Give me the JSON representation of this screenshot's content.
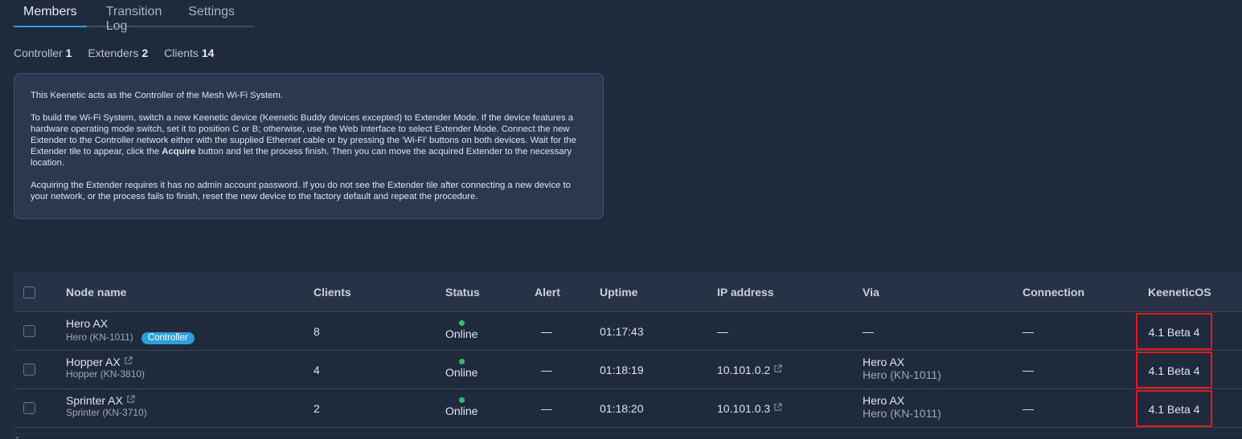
{
  "tabs": [
    "Members",
    "Transition Log",
    "Settings"
  ],
  "counts": [
    {
      "label": "Controller",
      "value": "1"
    },
    {
      "label": "Extenders",
      "value": "2"
    },
    {
      "label": "Clients",
      "value": "14"
    }
  ],
  "info": {
    "p1": "This Keenetic acts as the Controller of the Mesh Wi-Fi System.",
    "p2_a": "To build the Wi-Fi System, switch a new Keenetic device (Keenetic Buddy devices excepted) to Extender Mode. If the device features a hardware operating mode switch, set it to position C or B; otherwise, use the Web Interface to select Extender Mode. Connect the new Extender to the Controller network either with the supplied Ethernet cable or by pressing the 'Wi-Fi' buttons on both devices. Wait for the Extender tile to appear, click the ",
    "p2_bold": "Acquire",
    "p2_b": " button and let the process finish. Then you can move the acquired Extender to the necessary location.",
    "p3": "Acquiring the Extender requires it has no admin account password. If you do not see the Extender tile after connecting a new device to your network, or the process fails to finish, reset the new device to the factory default and repeat the procedure."
  },
  "table": {
    "headers": {
      "node": "Node name",
      "clients": "Clients",
      "status": "Status",
      "alert": "Alert",
      "uptime": "Uptime",
      "ip": "IP address",
      "via": "Via",
      "connection": "Connection",
      "os": "KeeneticOS"
    },
    "rows": [
      {
        "name": "Hero AX",
        "model": "Hero (KN-1011)",
        "badge": "Controller",
        "clients": "8",
        "status": "Online",
        "alert": "—",
        "uptime": "01:17:43",
        "ip": "—",
        "via": "—",
        "via_model": "",
        "connection": "—",
        "os": "4.1 Beta 4"
      },
      {
        "name": "Hopper AX",
        "model": "Hopper (KN-3810)",
        "badge": "",
        "clients": "4",
        "status": "Online",
        "alert": "—",
        "uptime": "01:18:19",
        "ip": "10.101.0.2",
        "via": "Hero AX",
        "via_model": "Hero (KN-1011)",
        "connection": "—",
        "os": "4.1 Beta 4"
      },
      {
        "name": "Sprinter AX",
        "model": "Sprinter (KN-3710)",
        "badge": "",
        "clients": "2",
        "status": "Online",
        "alert": "—",
        "uptime": "01:18:20",
        "ip": "10.101.0.3",
        "via": "Hero AX",
        "via_model": "Hero (KN-1011)",
        "connection": "—",
        "os": "4.1 Beta 4"
      }
    ]
  },
  "colors": {
    "accent": "#2f9fdb",
    "online": "#2bc46b",
    "highlight": "#e01a1a"
  }
}
